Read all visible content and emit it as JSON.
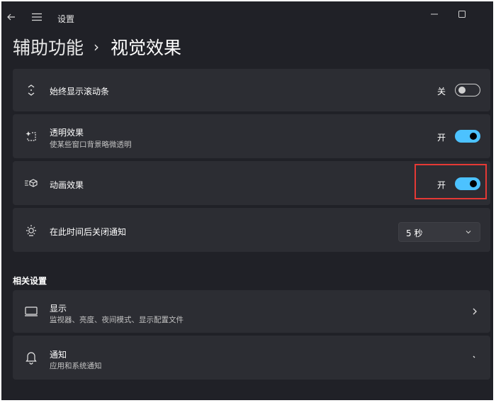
{
  "window": {
    "app_title": "设置"
  },
  "breadcrumb": {
    "parent": "辅助功能",
    "separator": "›",
    "current": "视觉效果"
  },
  "settings": [
    {
      "icon": "scrollbar-icon",
      "title": "始终显示滚动条",
      "state_label": "关",
      "toggle_on": false
    },
    {
      "icon": "transparency-icon",
      "title": "透明效果",
      "subtitle": "使某些窗口背景略微透明",
      "state_label": "开",
      "toggle_on": true
    },
    {
      "icon": "animation-icon",
      "title": "动画效果",
      "state_label": "开",
      "toggle_on": true,
      "highlighted": true
    },
    {
      "icon": "brightness-icon",
      "title": "在此时间后关闭通知",
      "dropdown_value": "5 秒"
    }
  ],
  "related": {
    "heading": "相关设置",
    "items": [
      {
        "icon": "display-icon",
        "title": "显示",
        "subtitle": "监视器、亮度、夜间模式、显示配置文件"
      },
      {
        "icon": "bell-icon",
        "title": "通知",
        "subtitle": "应用和系统通知"
      }
    ]
  },
  "colors": {
    "window_bg": "#202127",
    "card_bg": "#2c2d33",
    "accent": "#4cc2ff",
    "highlight_border": "#e53935"
  }
}
